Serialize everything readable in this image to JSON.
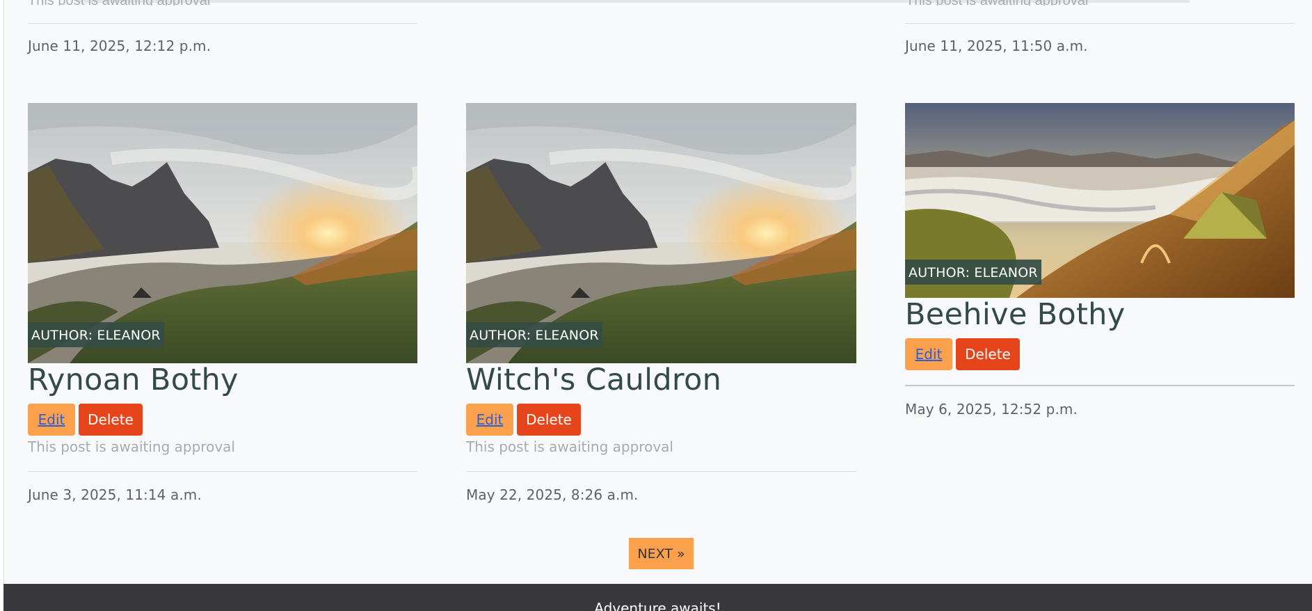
{
  "top_row": {
    "left_partial_text": "This post is awaiting approval",
    "right_partial_text": "This post is awaiting approval",
    "left_date": "June 11, 2025, 12:12 p.m.",
    "right_date": "June 11, 2025, 11:50 a.m."
  },
  "cards": [
    {
      "title": "Rynoan Bothy",
      "author_badge": "AUTHOR: ELEANOR",
      "edit_label": "Edit",
      "delete_label": "Delete",
      "status": "This post is awaiting approval",
      "date": "June 3, 2025, 11:14 a.m.",
      "image": "coastal-sunset-camp"
    },
    {
      "title": "Witch's Cauldron",
      "author_badge": "AUTHOR: ELEANOR",
      "edit_label": "Edit",
      "delete_label": "Delete",
      "status": "This post is awaiting approval",
      "date": "May 22, 2025, 8:26 a.m.",
      "image": "coastal-sunset-camp"
    },
    {
      "title": "Beehive Bothy",
      "author_badge": "AUTHOR: ELEANOR",
      "edit_label": "Edit",
      "delete_label": "Delete",
      "status": "",
      "date": "May 6, 2025, 12:52 p.m.",
      "image": "mountain-tent-clouds"
    }
  ],
  "pagination": {
    "next_label": "NEXT »"
  },
  "footer": {
    "text": "Adventure awaits!"
  },
  "colors": {
    "edit_button": "#fba04d",
    "delete_button": "#e6451c",
    "badge": "#344c44",
    "title": "#344b45",
    "footer": "#39383d"
  }
}
